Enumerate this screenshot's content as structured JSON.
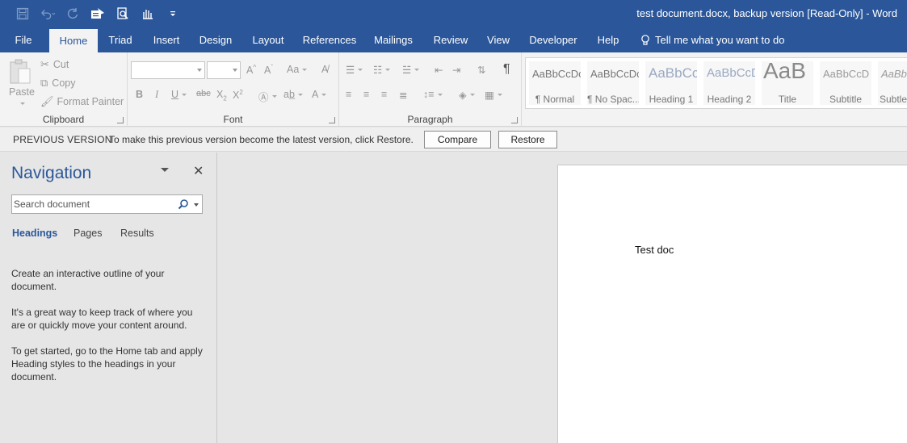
{
  "window": {
    "title": "test document.docx, backup version [Read-Only]  -  Word"
  },
  "quick_access": [
    {
      "name": "save-icon"
    },
    {
      "name": "undo-icon"
    },
    {
      "name": "redo-icon"
    },
    {
      "name": "customize-icon"
    },
    {
      "name": "print-preview-icon"
    },
    {
      "name": "touch-mode-icon"
    },
    {
      "name": "qat-dropdown-icon"
    }
  ],
  "tabs": [
    {
      "label": "File"
    },
    {
      "label": "Home",
      "active": true
    },
    {
      "label": "Triad"
    },
    {
      "label": "Insert"
    },
    {
      "label": "Design"
    },
    {
      "label": "Layout"
    },
    {
      "label": "References"
    },
    {
      "label": "Mailings"
    },
    {
      "label": "Review"
    },
    {
      "label": "View"
    },
    {
      "label": "Developer"
    },
    {
      "label": "Help"
    }
  ],
  "tell_me": "Tell me what you want to do",
  "ribbon": {
    "clipboard": {
      "label": "Clipboard",
      "paste": "Paste",
      "cut": "Cut",
      "copy": "Copy",
      "format_painter": "Format Painter"
    },
    "font": {
      "label": "Font",
      "font_name": "",
      "font_size": ""
    },
    "paragraph": {
      "label": "Paragraph"
    },
    "styles": [
      {
        "sample": "AaBbCcDc",
        "name": "¶ Normal"
      },
      {
        "sample": "AaBbCcDc",
        "name": "¶ No Spac..."
      },
      {
        "sample": "AaBbCc",
        "name": "Heading 1"
      },
      {
        "sample": "AaBbCcD",
        "name": "Heading 2"
      },
      {
        "sample": "AaB",
        "name": "Title"
      },
      {
        "sample": "AaBbCcD",
        "name": "Subtitle"
      },
      {
        "sample": "AaBbC",
        "name": "Subtle"
      }
    ]
  },
  "previous_version": {
    "label": "PREVIOUS VERSION",
    "message": "To make this previous version become the latest version, click Restore.",
    "compare": "Compare",
    "restore": "Restore"
  },
  "navigation": {
    "title": "Navigation",
    "search_placeholder": "Search document",
    "tabs": [
      {
        "label": "Headings",
        "active": true
      },
      {
        "label": "Pages"
      },
      {
        "label": "Results"
      }
    ],
    "paragraphs": [
      "Create an interactive outline of your document.",
      "It's a great way to keep track of where you are or quickly move your content around.",
      "To get started, go to the Home tab and apply Heading styles to the headings in your document."
    ]
  },
  "document": {
    "text": "Test doc"
  },
  "colors": {
    "brand": "#2b579a",
    "ribbon_bg": "#f3f3f3",
    "pane_bg": "#e6e6e6"
  }
}
